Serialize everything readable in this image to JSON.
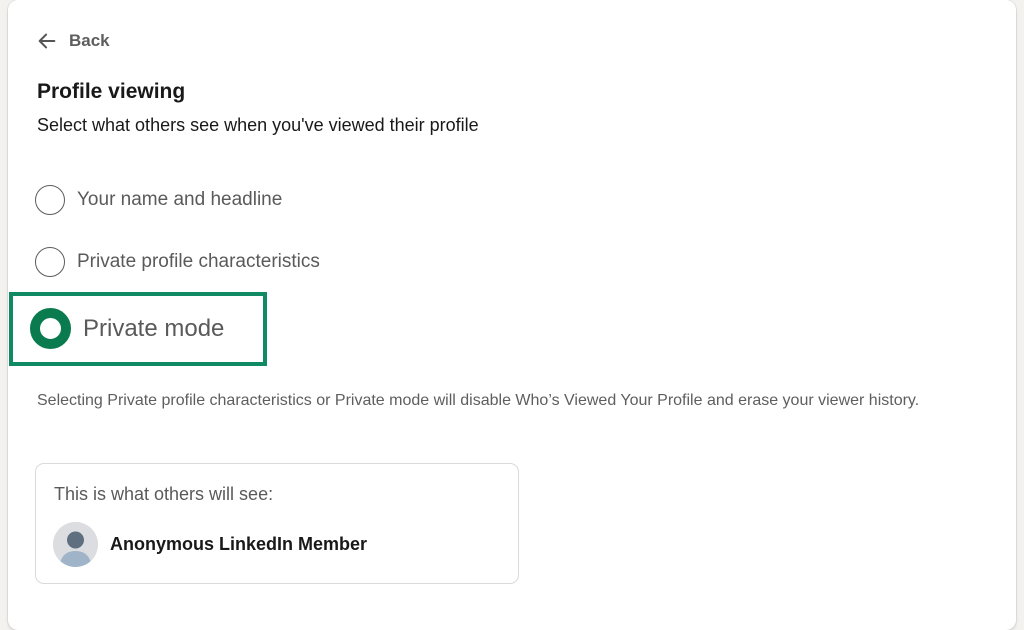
{
  "nav": {
    "back_label": "Back",
    "back_icon": "arrow-left-icon"
  },
  "page": {
    "title": "Profile viewing",
    "subtitle": "Select what others see when you've viewed their profile"
  },
  "options": [
    {
      "label": "Your name and headline",
      "selected": false
    },
    {
      "label": "Private profile characteristics",
      "selected": false
    },
    {
      "label": "Private mode",
      "selected": true
    }
  ],
  "note": "Selecting Private profile characteristics or Private mode will disable Who’s Viewed Your Profile and erase your viewer history.",
  "preview": {
    "title": "This is what others will see:",
    "member_name": "Anonymous LinkedIn Member",
    "avatar_icon": "anonymous-avatar-icon"
  },
  "colors": {
    "selected_radio": "#0a7a4f",
    "highlight_border": "#0f8a63"
  }
}
